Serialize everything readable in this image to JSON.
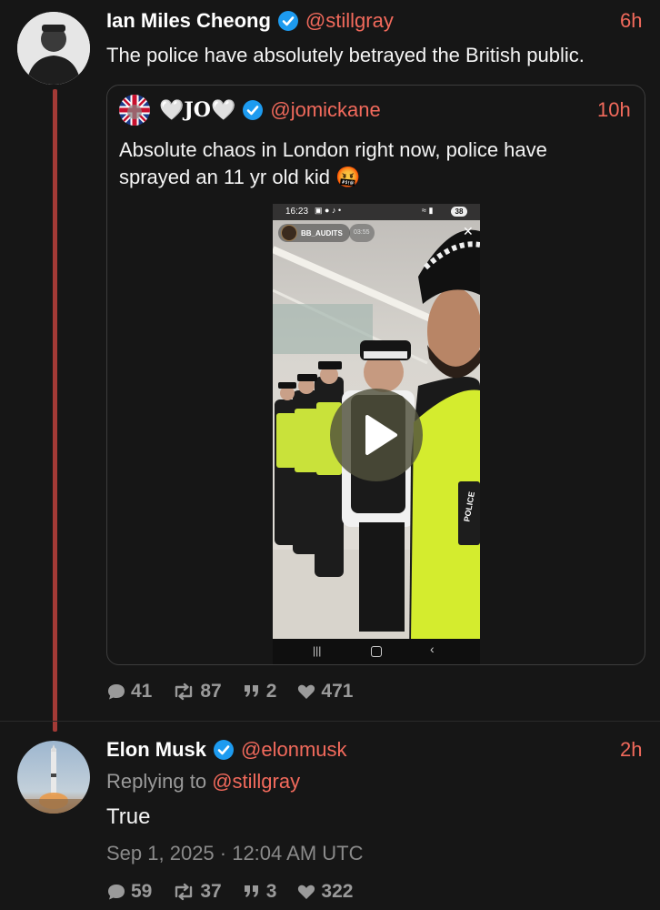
{
  "tweet": {
    "author_name": "Ian Miles Cheong",
    "author_handle": "@stillgray",
    "time": "6h",
    "text": "The police have absolutely betrayed the British public.",
    "quoted": {
      "author_name": "🤍JO🤍",
      "author_handle": "@jomickane",
      "time": "10h",
      "text_line1": "Absolute chaos in London right now, police have",
      "text_line2": "sprayed an 11 yr old kid 🤬",
      "video": {
        "status_time": "16:23",
        "status_battery": "38",
        "channel_label": "BB_AUDITS",
        "duration": "03:55",
        "vest_text": "POLICE"
      }
    },
    "stats": {
      "replies": "41",
      "retweets": "87",
      "quotes": "2",
      "likes": "471"
    }
  },
  "reply": {
    "author_name": "Elon Musk",
    "author_handle": "@elonmusk",
    "time": "2h",
    "replying_prefix": "Replying to",
    "replying_handle": "@stillgray",
    "text": "True",
    "timestamp": "Sep 1, 2025 · 12:04 AM UTC",
    "stats": {
      "replies": "59",
      "retweets": "37",
      "quotes": "3",
      "likes": "322"
    }
  },
  "colors": {
    "background": "#161616",
    "accent": "#f26a5c",
    "thread_line": "#a33a36",
    "verified": "#1d9bf0"
  }
}
